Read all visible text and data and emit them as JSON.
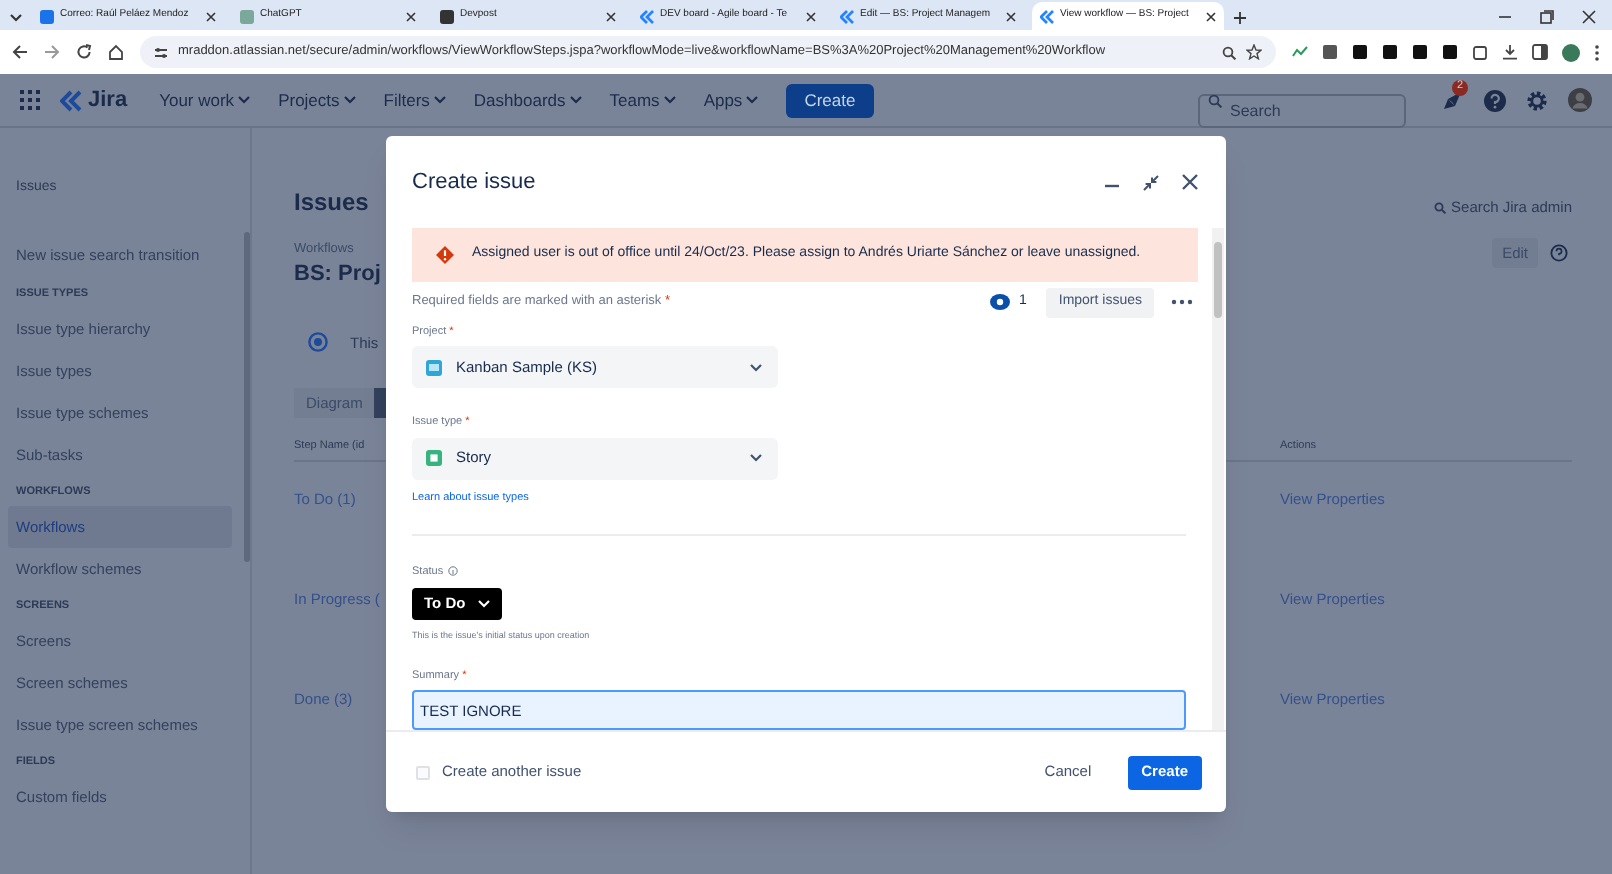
{
  "browser": {
    "tabs": [
      {
        "title": "Correo: Raúl Peláez Mendoz",
        "selected": false
      },
      {
        "title": "ChatGPT",
        "selected": false
      },
      {
        "title": "Devpost",
        "selected": false
      },
      {
        "title": "DEV board - Agile board - Te",
        "selected": false
      },
      {
        "title": "Edit — BS: Project Managem",
        "selected": false
      },
      {
        "title": "View workflow — BS: Project",
        "selected": true
      }
    ],
    "url": "mraddon.atlassian.net/secure/admin/workflows/ViewWorkflowSteps.jspa?workflowMode=live&workflowName=BS%3A%20Project%20Management%20Workflow"
  },
  "nav": {
    "logo": "Jira",
    "items": [
      "Your work",
      "Projects",
      "Filters",
      "Dashboards",
      "Teams",
      "Apps"
    ],
    "create": "Create",
    "search_placeholder": "Search",
    "notifications": "2"
  },
  "sidebar": {
    "title": "Issues",
    "sections": [
      {
        "items": [
          {
            "label": "New issue search transition",
            "selected": false
          }
        ]
      },
      {
        "heading": "ISSUE TYPES",
        "items": [
          {
            "label": "Issue type hierarchy",
            "selected": false
          },
          {
            "label": "Issue types",
            "selected": false
          },
          {
            "label": "Issue type schemes",
            "selected": false
          },
          {
            "label": "Sub-tasks",
            "selected": false
          }
        ]
      },
      {
        "heading": "WORKFLOWS",
        "items": [
          {
            "label": "Workflows",
            "selected": true
          },
          {
            "label": "Workflow schemes",
            "selected": false
          }
        ]
      },
      {
        "heading": "SCREENS",
        "items": [
          {
            "label": "Screens",
            "selected": false
          },
          {
            "label": "Screen schemes",
            "selected": false
          },
          {
            "label": "Issue type screen schemes",
            "selected": false
          }
        ]
      },
      {
        "heading": "FIELDS",
        "items": [
          {
            "label": "Custom fields",
            "selected": false
          }
        ]
      }
    ]
  },
  "main": {
    "heading": "Issues",
    "breadcrumb": "Workflows",
    "title": "BS: Proj",
    "info_text": "This",
    "search_admin": "Search Jira admin",
    "edit": "Edit",
    "view_tabs": [
      {
        "label": "Diagram",
        "selected": false
      },
      {
        "selected": true
      }
    ],
    "table": {
      "columns": [
        "Step Name (id",
        "Actions"
      ],
      "rows": [
        {
          "step": "To Do (1)",
          "action": "View Properties"
        },
        {
          "step": "In Progress (",
          "action": "View Properties"
        },
        {
          "step": "Done (3)",
          "action": "View Properties"
        }
      ]
    }
  },
  "modal": {
    "title": "Create issue",
    "alert": "Assigned user is out of office until 24/Oct/23. Please assign to Andrés Uriarte Sánchez or leave unassigned.",
    "required_note": {
      "text": "Required fields are marked with an asterisk",
      "mark": "*"
    },
    "watchers": "1",
    "import_button": "Import issues",
    "project": {
      "label": "Project",
      "mark": "*",
      "value": "Kanban Sample (KS)"
    },
    "issue_type": {
      "label": "Issue type",
      "mark": "*",
      "value": "Story",
      "link": "Learn about issue types"
    },
    "status": {
      "label": "Status",
      "value": "To Do",
      "help": "This is the issue's initial status upon creation"
    },
    "summary": {
      "label": "Summary",
      "mark": "*",
      "value": "TEST IGNORE",
      "focused": true
    },
    "create_another": {
      "label": "Create another issue",
      "checked": false
    },
    "cancel": "Cancel",
    "create": "Create"
  }
}
